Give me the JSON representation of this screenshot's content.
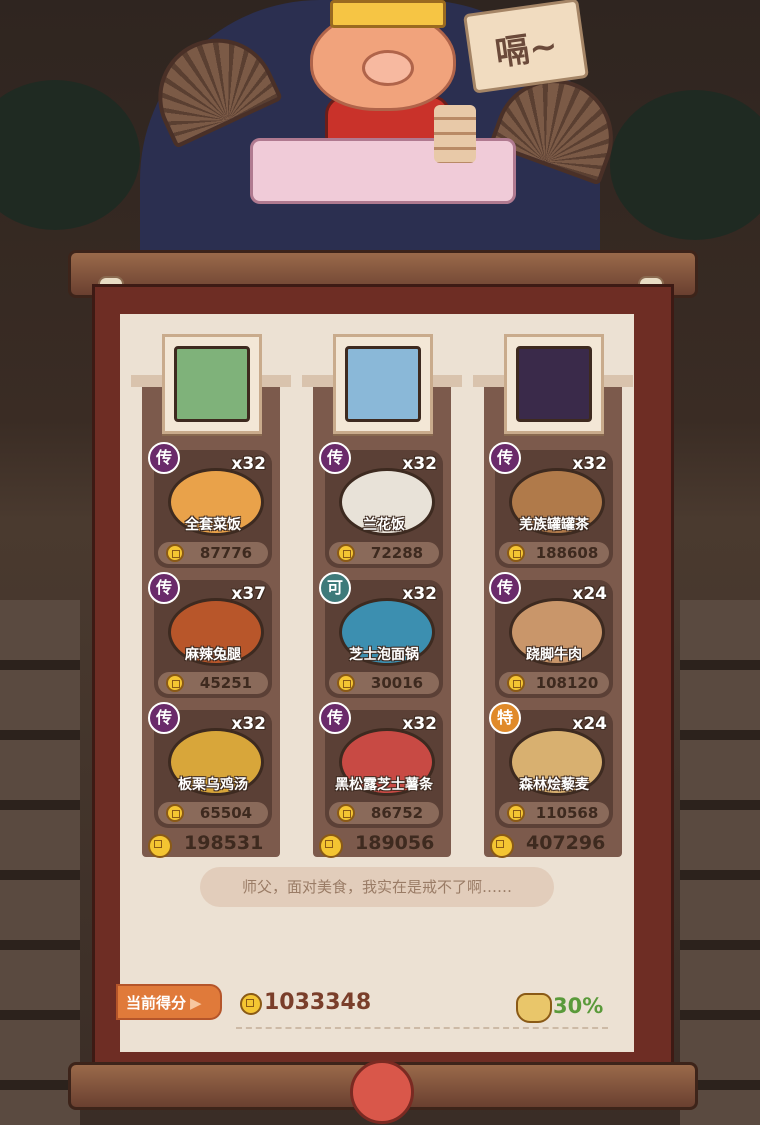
{
  "header": {
    "sign_text": "嗝~"
  },
  "columns": [
    {
      "portrait": "character-green-hair",
      "total": "198531",
      "dishes": [
        {
          "badge": "传",
          "qty": "x32",
          "name": "全套菜饭",
          "score": "87776",
          "plate_color": "#e9a24a"
        },
        {
          "badge": "传",
          "qty": "x37",
          "name": "麻辣兔腿",
          "score": "45251",
          "plate_color": "#b8562a"
        },
        {
          "badge": "传",
          "qty": "x32",
          "name": "板栗乌鸡汤",
          "score": "65504",
          "plate_color": "#d8a63a"
        }
      ]
    },
    {
      "portrait": "character-white-hair",
      "total": "189056",
      "dishes": [
        {
          "badge": "传",
          "qty": "x32",
          "name": "兰花饭",
          "score": "72288",
          "plate_color": "#e8e2d8"
        },
        {
          "badge": "可",
          "qty": "x32",
          "name": "芝士泡面锅",
          "score": "30016",
          "plate_color": "#3c8fb0"
        },
        {
          "badge": "传",
          "qty": "x32",
          "name": "黑松露芝士薯条",
          "score": "86752",
          "plate_color": "#c84a44"
        }
      ]
    },
    {
      "portrait": "character-dark-hair",
      "total": "407296",
      "dishes": [
        {
          "badge": "传",
          "qty": "x32",
          "name": "羌族罐罐茶",
          "score": "188608",
          "plate_color": "#b07a4a"
        },
        {
          "badge": "传",
          "qty": "x24",
          "name": "跷脚牛肉",
          "score": "108120",
          "plate_color": "#c9966a"
        },
        {
          "badge": "特",
          "qty": "x24",
          "name": "森林烩藜麦",
          "score": "110568",
          "plate_color": "#d8b070"
        }
      ]
    }
  ],
  "quote": "师父，面对美食，我实在是戒不了啊……",
  "footer": {
    "score_label": "当前得分",
    "total_score": "1033348",
    "percent": "30%"
  },
  "colors": {
    "badge_legend": "#6a2a6a",
    "badge_rare": "#3e7a7a",
    "badge_special": "#e08a2a",
    "coin": "#f4c532",
    "percent": "#5a9a3a"
  }
}
